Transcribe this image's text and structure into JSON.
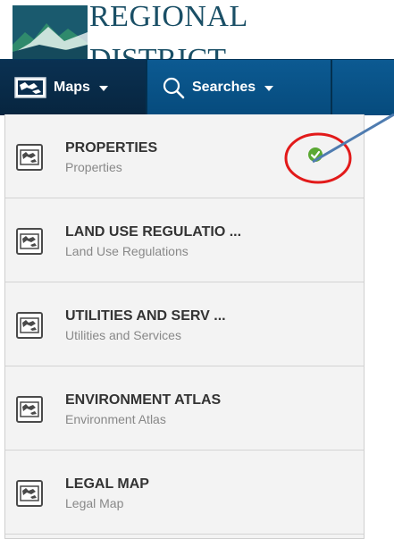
{
  "logo": {
    "line1": "REGIONAL",
    "line2": "DISTRICT"
  },
  "navbar": {
    "maps_label": "Maps",
    "searches_label": "Searches"
  },
  "map_list": [
    {
      "title": "PROPERTIES",
      "subtitle": "Properties",
      "active": true
    },
    {
      "title": "LAND USE REGULATIO ...",
      "subtitle": "Land Use Regulations",
      "active": false
    },
    {
      "title": "UTILITIES AND SERV ...",
      "subtitle": "Utilities and Services",
      "active": false
    },
    {
      "title": "ENVIRONMENT ATLAS",
      "subtitle": "Environment Atlas",
      "active": false
    },
    {
      "title": "LEGAL MAP",
      "subtitle": "Legal Map",
      "active": false
    }
  ],
  "colors": {
    "nav_bg": "#0a5a90",
    "nav_active_bg": "#0a2e4e",
    "check_green": "#5aa832",
    "annotation_red": "#e21a1a",
    "arrow_blue": "#4f7cb0"
  },
  "icons": {
    "maps_nav": "map-icon",
    "searches_nav": "search-icon",
    "list_item": "map-icon",
    "active_marker": "check-icon"
  }
}
